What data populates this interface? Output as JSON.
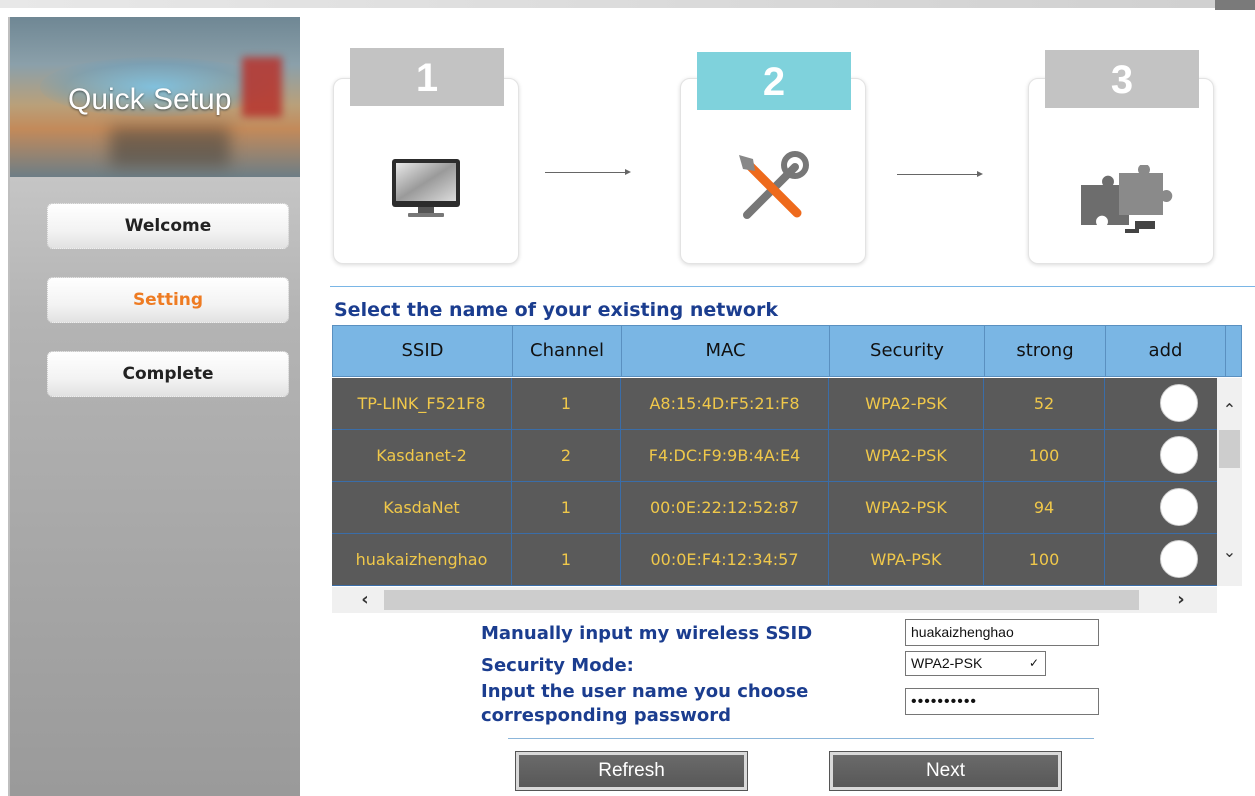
{
  "sidebar": {
    "title": "Quick Setup",
    "items": [
      {
        "label": "Welcome",
        "active": false
      },
      {
        "label": "Setting",
        "active": true
      },
      {
        "label": "Complete",
        "active": false
      }
    ]
  },
  "steps": [
    {
      "number": "1",
      "icon": "monitor-icon",
      "active": false
    },
    {
      "number": "2",
      "icon": "tools-icon",
      "active": true
    },
    {
      "number": "3",
      "icon": "puzzle-icon",
      "active": false
    }
  ],
  "network": {
    "title": "Select the name of your existing network",
    "columns": [
      "SSID",
      "Channel",
      "MAC",
      "Security",
      "strong",
      "add"
    ],
    "rows": [
      {
        "ssid": "TP-LINK_F521F8",
        "channel": "1",
        "mac": "A8:15:4D:F5:21:F8",
        "security": "WPA2-PSK",
        "strong": "52"
      },
      {
        "ssid": "Kasdanet-2",
        "channel": "2",
        "mac": "F4:DC:F9:9B:4A:E4",
        "security": "WPA2-PSK",
        "strong": "100"
      },
      {
        "ssid": "KasdaNet",
        "channel": "1",
        "mac": "00:0E:22:12:52:87",
        "security": "WPA2-PSK",
        "strong": "94"
      },
      {
        "ssid": "huakaizhenghao",
        "channel": "1",
        "mac": "00:0E:F4:12:34:57",
        "security": "WPA-PSK",
        "strong": "100"
      }
    ]
  },
  "form": {
    "ssid_label": "Manually input my wireless SSID",
    "ssid_value": "huakaizhenghao",
    "security_label": "Security Mode:",
    "security_value": "WPA2-PSK",
    "password_label_line1": "Input the user name you choose",
    "password_label_line2": "corresponding password",
    "password_value": "••••••••••"
  },
  "buttons": {
    "refresh": "Refresh",
    "next": "Next"
  },
  "colors": {
    "accent_orange": "#ee7b22",
    "header_blue": "#7ab6e4",
    "title_blue": "#1b3d8f",
    "row_bg": "#5a5a5a",
    "row_text": "#f0c84a",
    "step_active": "#7fd2dc"
  }
}
